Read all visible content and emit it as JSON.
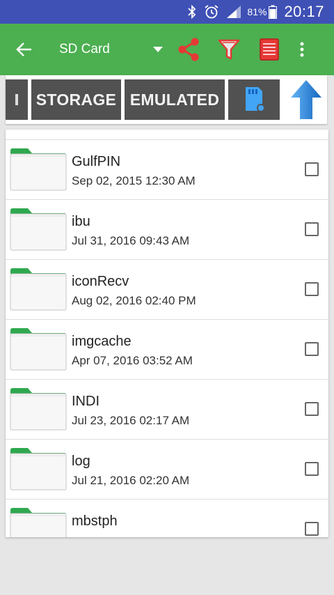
{
  "status_bar": {
    "battery_percent": "81%",
    "time": "20:17",
    "icons": [
      "bluetooth-icon",
      "alarm-icon",
      "signal-icon",
      "battery-icon"
    ]
  },
  "toolbar": {
    "title": "SD Card",
    "icons": [
      "back-arrow-icon",
      "dropdown-arrow-icon",
      "share-icon",
      "filter-icon",
      "list-icon",
      "more-vert-icon"
    ]
  },
  "path_bar": {
    "crumbs": [
      "STORAGE",
      "EMULATED"
    ],
    "icons": [
      "sd-card-icon",
      "up-arrow-icon"
    ]
  },
  "file_list": {
    "items": [
      {
        "name": "GulfPIN",
        "date": "Sep 02, 2015 12:30 AM"
      },
      {
        "name": "ibu",
        "date": "Jul 31, 2016 09:43 AM"
      },
      {
        "name": "iconRecv",
        "date": "Aug 02, 2016 02:40 PM"
      },
      {
        "name": "imgcache",
        "date": "Apr 07, 2016 03:52 AM"
      },
      {
        "name": "INDI",
        "date": "Jul 23, 2016 02:17 AM"
      },
      {
        "name": "log",
        "date": "Jul 21, 2016 02:20 AM"
      },
      {
        "name": "mbstph",
        "date": ""
      }
    ]
  },
  "colors": {
    "status_bar": "#3f51b5",
    "toolbar": "#4caf50",
    "crumb_bg": "#515151",
    "action_red": "#e53935",
    "up_arrow_blue": "#1e88e5"
  }
}
